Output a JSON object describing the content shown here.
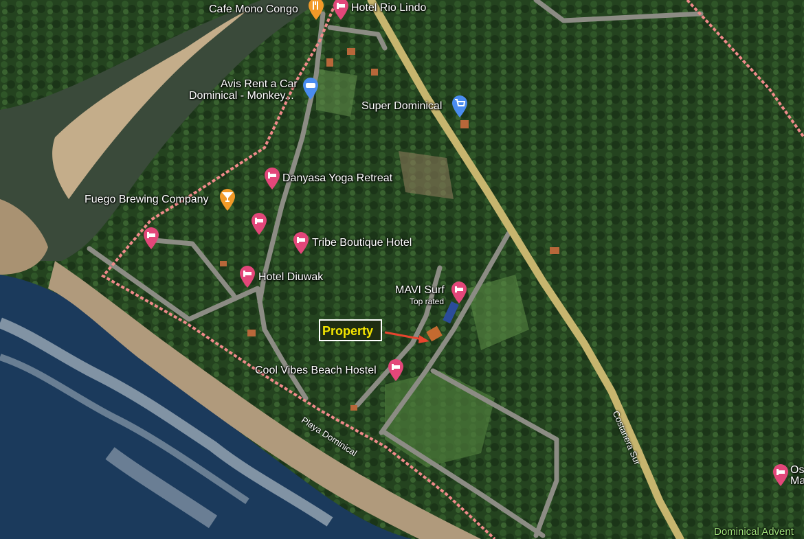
{
  "colors": {
    "forest": "#24431f",
    "ocean": "#1b3a5c",
    "beach": "#b09a7c",
    "road": "#8c8c84",
    "highway": "#c7b56e",
    "boundary": "#f08a8a",
    "lodging_pin": "#e3477a",
    "food_pin": "#f29a28",
    "shop_pin": "#4a8cf0",
    "property_text": "#f5e600",
    "arrow": "#e8452e"
  },
  "places": {
    "cafe_mono_congo": "Cafe Mono Congo",
    "hotel_rio_lindo": "Hotel Rio Lindo",
    "avis_line1": "Avis Rent a Car",
    "avis_line2": "Dominical - Monkey...",
    "super_dominical": "Super Dominical",
    "danyasa": "Danyasa Yoga Retreat",
    "fuego": "Fuego Brewing Company",
    "tribe": "Tribe Boutique Hotel",
    "diuwak": "Hotel Diuwak",
    "mavi": "MAVI Surf",
    "mavi_sub": "Top rated",
    "cool_vibes": "Cool Vibes Beach Hostel",
    "os_line1": "Os",
    "os_line2": "Ma",
    "dominical_adv": "Dominical Advent"
  },
  "roads": {
    "playa": "Playa Dominical",
    "costanera": "Costanera Sur"
  },
  "property_label": "Property",
  "icons": {
    "lodging": "bed-icon",
    "restaurant": "fork-knife-icon",
    "bar": "cocktail-icon",
    "car_rental": "car-icon",
    "shopping": "cart-icon"
  }
}
